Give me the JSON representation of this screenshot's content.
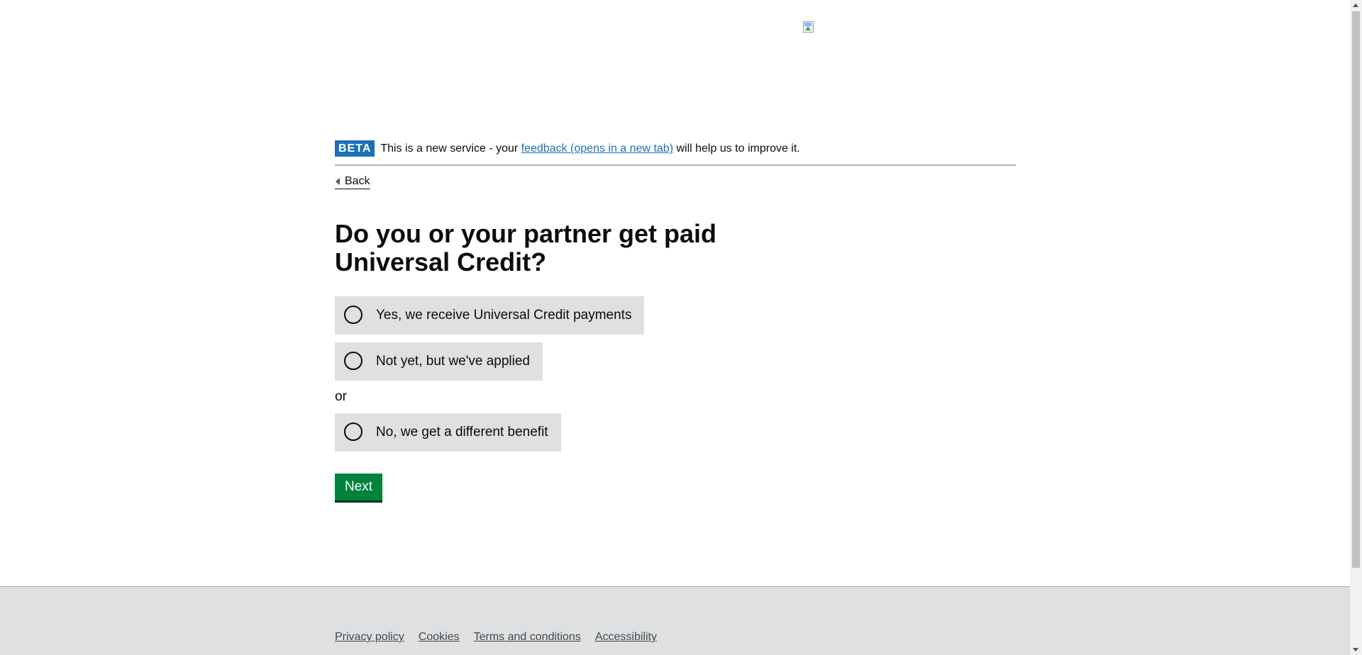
{
  "header": {
    "logo_icon": "broken-image-icon"
  },
  "phase_banner": {
    "tag": "BETA",
    "text_before": "This is a new service - your ",
    "link_text": "feedback (opens in a new tab)",
    "text_after": " will help us to improve it."
  },
  "back_link": {
    "label": "Back"
  },
  "question": {
    "title": "Do you or your partner get paid Universal Credit?"
  },
  "options": [
    {
      "label": "Yes, we receive Universal Credit payments",
      "selected": false
    },
    {
      "label": "Not yet, but we've applied",
      "selected": false
    },
    {
      "label": "No, we get a different benefit",
      "selected": false
    }
  ],
  "divider": {
    "text": "or"
  },
  "actions": {
    "next_label": "Next"
  },
  "footer": {
    "links": [
      "Privacy policy",
      "Cookies",
      "Terms and conditions",
      "Accessibility"
    ]
  },
  "colors": {
    "phase_tag_bg": "#1d70b8",
    "link": "#1d70b8",
    "option_bg": "#dee0e2",
    "button_bg": "#00823b",
    "footer_bg": "#dee0e2"
  }
}
